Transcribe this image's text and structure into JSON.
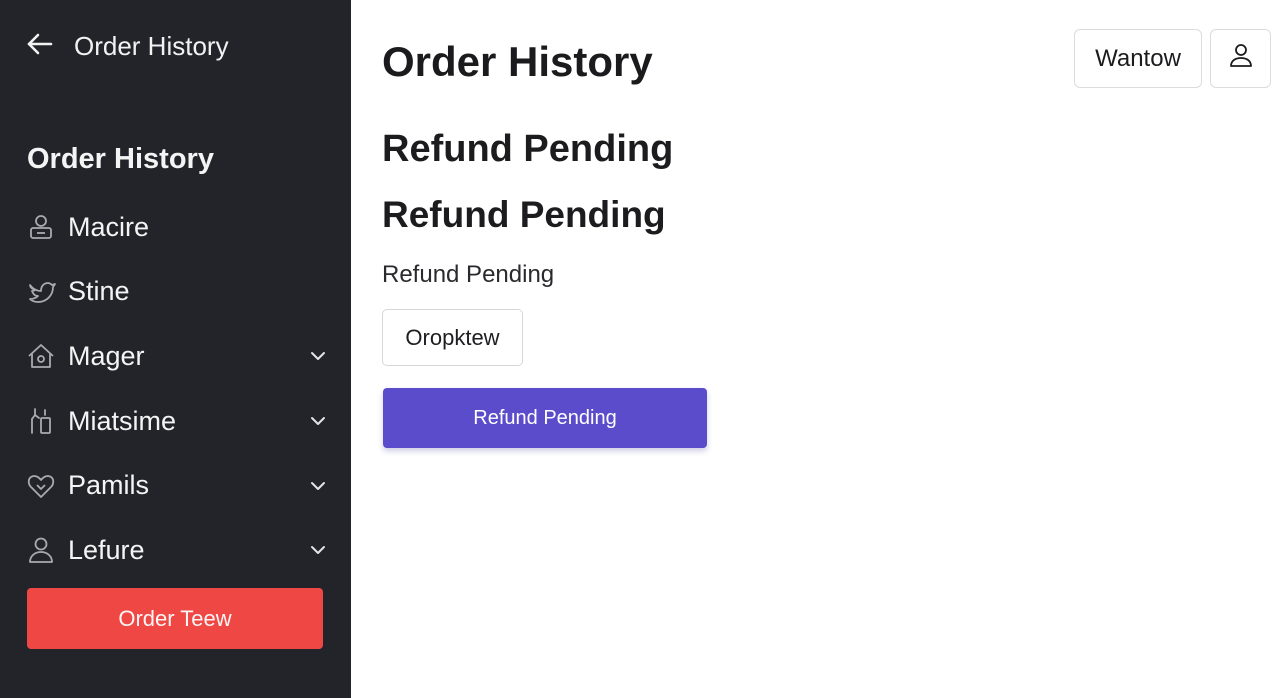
{
  "sidebar": {
    "back_label": "Order History",
    "heading": "Order History",
    "items": [
      {
        "label": "Macire",
        "icon": "person-badge-icon",
        "has_chevron": false
      },
      {
        "label": "Stine",
        "icon": "bird-icon",
        "has_chevron": false
      },
      {
        "label": "Mager",
        "icon": "house-icon",
        "has_chevron": true
      },
      {
        "label": "Miatsime",
        "icon": "figure-icon",
        "has_chevron": true
      },
      {
        "label": "Pamils",
        "icon": "heart-icon",
        "has_chevron": true
      },
      {
        "label": "Lefure",
        "icon": "user-icon",
        "has_chevron": true
      }
    ],
    "cta_label": "Order Teew"
  },
  "header": {
    "title": "Order History",
    "wantow_label": "Wantow"
  },
  "main": {
    "heading_1": "Refund Pending",
    "heading_2": "Refund Pending",
    "subtext": "Refund Pending",
    "option_button": "Oropktew",
    "primary_button": "Refund Pending"
  },
  "colors": {
    "sidebar_bg": "#232429",
    "cta_red": "#ee4744",
    "primary_purple": "#5a4ccb"
  }
}
